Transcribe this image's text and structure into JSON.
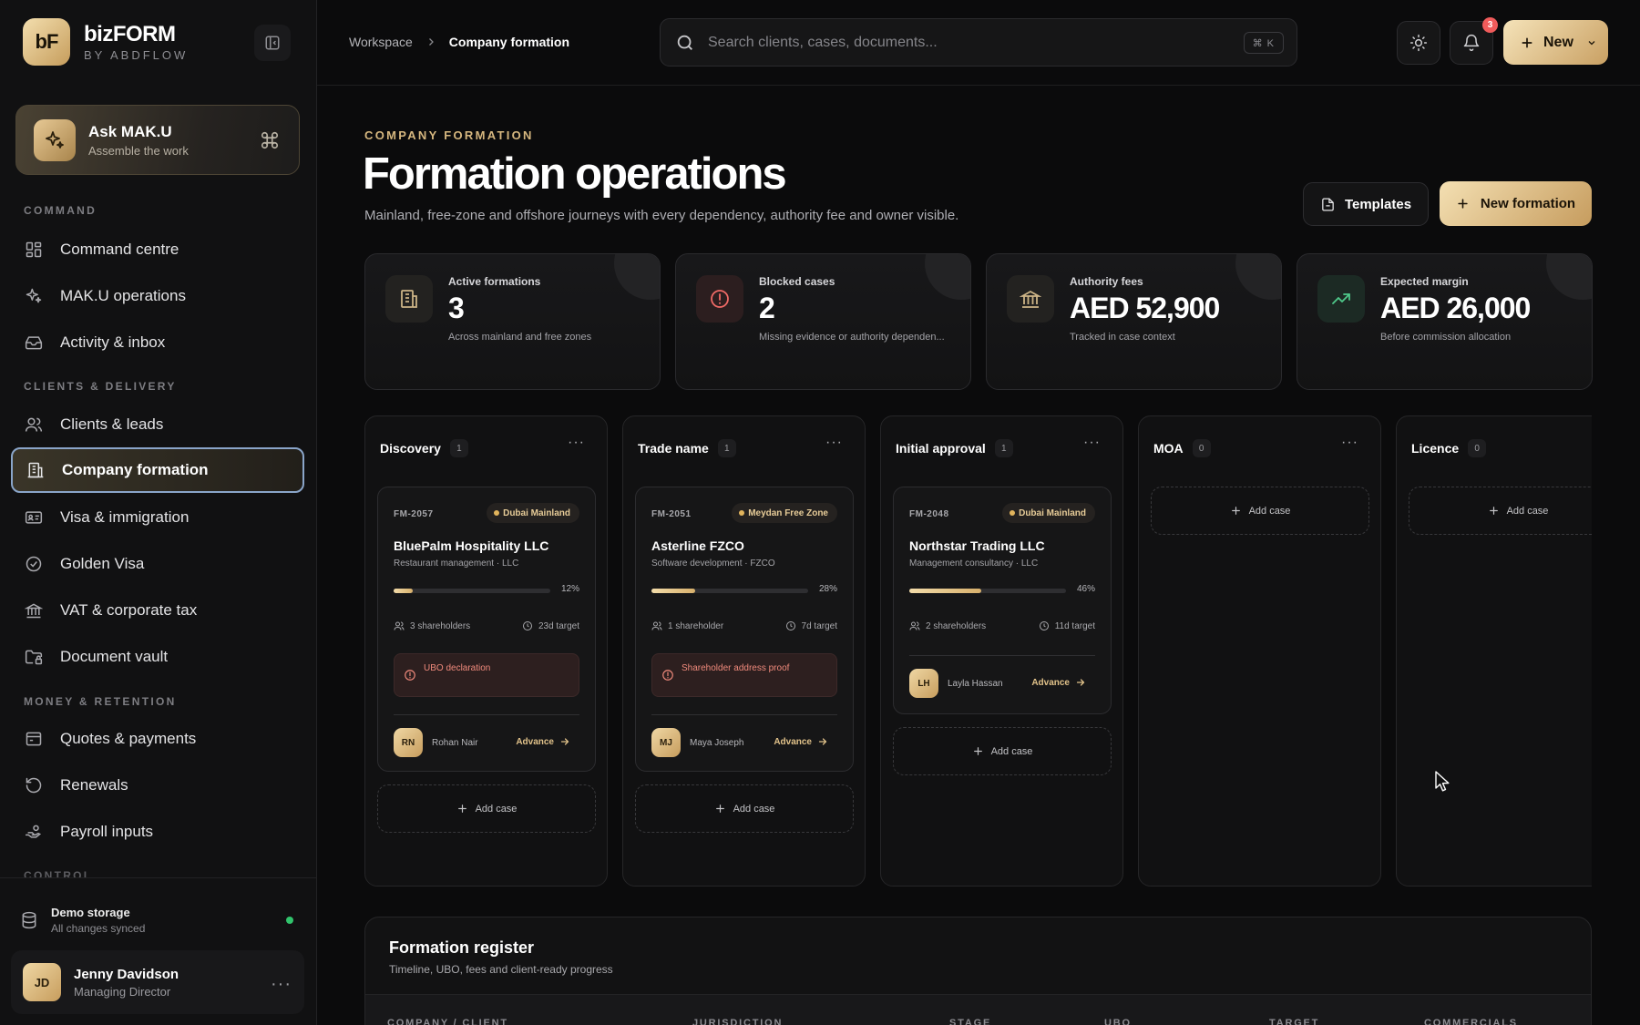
{
  "brand": {
    "logo": "bF",
    "name": "bizFORM",
    "subtitle": "BY ABDFLOW"
  },
  "ask": {
    "title": "Ask MAK.U",
    "subtitle": "Assemble the work",
    "icon": "sparkles-icon",
    "shortcut_icon": "command-icon"
  },
  "sidebar": {
    "sections": [
      {
        "label": "COMMAND"
      },
      {
        "label": "CLIENTS & DELIVERY"
      },
      {
        "label": "MONEY & RETENTION"
      },
      {
        "label": "CONTROL"
      }
    ],
    "items": [
      {
        "label": "Command centre",
        "icon": "grid-icon"
      },
      {
        "label": "MAK.U operations",
        "icon": "sparkles-icon"
      },
      {
        "label": "Activity & inbox",
        "icon": "inbox-icon"
      },
      {
        "label": "Clients & leads",
        "icon": "users-icon"
      },
      {
        "label": "Company formation",
        "icon": "building-icon",
        "active": true
      },
      {
        "label": "Visa & immigration",
        "icon": "id-card-icon"
      },
      {
        "label": "Golden Visa",
        "icon": "badge-check-icon"
      },
      {
        "label": "VAT & corporate tax",
        "icon": "landmark-icon"
      },
      {
        "label": "Document vault",
        "icon": "folder-lock-icon"
      },
      {
        "label": "Quotes & payments",
        "icon": "receipt-icon"
      },
      {
        "label": "Renewals",
        "icon": "refresh-icon"
      },
      {
        "label": "Payroll inputs",
        "icon": "hand-coins-icon"
      }
    ]
  },
  "storage": {
    "title": "Demo storage",
    "subtitle": "All changes synced",
    "status_color": "#31c46c"
  },
  "user": {
    "initials": "JD",
    "name": "Jenny Davidson",
    "role": "Managing Director"
  },
  "breadcrumb": {
    "root": "Workspace",
    "current": "Company formation"
  },
  "search": {
    "placeholder": "Search clients, cases, documents...",
    "shortcut": "⌘ K"
  },
  "notifications": {
    "count": "3"
  },
  "new_button": {
    "label": "New"
  },
  "page": {
    "eyebrow": "COMPANY FORMATION",
    "title": "Formation operations",
    "description": "Mainland, free-zone and offshore journeys with every dependency, authority fee and owner visible.",
    "templates_label": "Templates",
    "new_formation_label": "New formation"
  },
  "stats": [
    {
      "label": "Active formations",
      "value": "3",
      "sub": "Across mainland and free zones",
      "icon": "building-icon"
    },
    {
      "label": "Blocked cases",
      "value": "2",
      "sub": "Missing evidence or authority dependen...",
      "icon": "alert-circle-icon"
    },
    {
      "label": "Authority fees",
      "value": "AED 52,900",
      "sub": "Tracked in case context",
      "icon": "landmark-icon"
    },
    {
      "label": "Expected margin",
      "value": "AED 26,000",
      "sub": "Before commission allocation",
      "icon": "trending-up-icon"
    }
  ],
  "kanban": {
    "add_label": "Add case",
    "advance_label": "Advance",
    "columns": [
      {
        "title": "Discovery",
        "count": "1"
      },
      {
        "title": "Trade name",
        "count": "1"
      },
      {
        "title": "Initial approval",
        "count": "1"
      },
      {
        "title": "MOA",
        "count": "0"
      },
      {
        "title": "Licence",
        "count": "0"
      }
    ],
    "cards": [
      {
        "id": "FM-2057",
        "zone": "Dubai Mainland",
        "name": "BluePalm Hospitality LLC",
        "type": "Restaurant management · LLC",
        "progress": 12,
        "progress_label": "12%",
        "shareholders": "3 shareholders",
        "target": "23d target",
        "alert": "UBO declaration",
        "owner_initials": "RN",
        "owner": "Rohan Nair"
      },
      {
        "id": "FM-2051",
        "zone": "Meydan Free Zone",
        "name": "Asterline FZCO",
        "type": "Software development · FZCO",
        "progress": 28,
        "progress_label": "28%",
        "shareholders": "1 shareholder",
        "target": "7d target",
        "alert": "Shareholder address proof",
        "owner_initials": "MJ",
        "owner": "Maya Joseph"
      },
      {
        "id": "FM-2048",
        "zone": "Dubai Mainland",
        "name": "Northstar Trading LLC",
        "type": "Management consultancy · LLC",
        "progress": 46,
        "progress_label": "46%",
        "shareholders": "2 shareholders",
        "target": "11d target",
        "alert": "",
        "owner_initials": "LH",
        "owner": "Layla Hassan"
      }
    ]
  },
  "register": {
    "title": "Formation register",
    "subtitle": "Timeline, UBO, fees and client-ready progress",
    "columns": [
      "COMPANY / CLIENT",
      "JURISDICTION",
      "STAGE",
      "UBO",
      "TARGET",
      "COMMERCIALS"
    ]
  },
  "colors": {
    "accent": "#d6b77f",
    "accent_gold": "#c9a063",
    "danger": "#f05b5b",
    "success": "#31c46c",
    "background": "#0b0b0c"
  }
}
